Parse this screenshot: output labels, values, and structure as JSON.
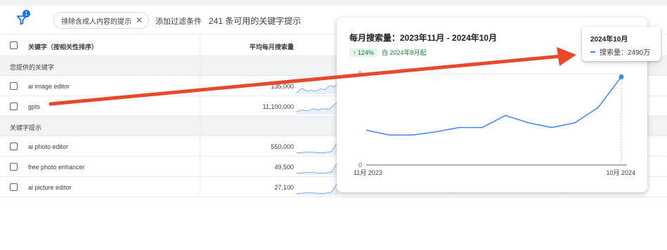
{
  "toolbar": {
    "filter_badge": "1",
    "chip_label": "排除含成人内容的提示",
    "add_filter": "添加过滤条件",
    "count_text": "241 条可用的关键字提示"
  },
  "table": {
    "header": {
      "keyword": "关键字（按相关性排序）",
      "volume": "平均每月搜索量"
    },
    "groups": [
      {
        "label": "您提供的关键字",
        "rows": [
          {
            "keyword": "ai image editor",
            "volume": "135,000"
          },
          {
            "keyword": "gpts",
            "volume": "11,100,000"
          }
        ]
      },
      {
        "label": "关键字提示",
        "rows": [
          {
            "keyword": "ai photo editor",
            "volume": "550,000"
          },
          {
            "keyword": "free photo enhancer",
            "volume": "49,500"
          },
          {
            "keyword": "ai picture editor",
            "volume": "27,100"
          }
        ]
      }
    ]
  },
  "popover": {
    "title": "每月搜索量：2023年11月 - 2024年10月",
    "growth_percent": "124%",
    "growth_since": "自 2024年8月起"
  },
  "tooltip": {
    "date": "2024年10月",
    "series_label": "搜索量：2490万"
  },
  "chart_data": {
    "type": "line",
    "x_start_label": "11月 2023",
    "x_end_label": "10月 2024",
    "y_zero_label": "0",
    "y_top_label": "0",
    "series": [
      {
        "values": [
          6.6,
          5.7,
          5.7,
          6.3,
          7.1,
          7.1,
          9.4,
          8.0,
          7.1,
          8.0,
          10.9,
          16.7
        ]
      }
    ],
    "colors": {
      "line": "#4285f4",
      "axis": "#5f6368",
      "grid": "#e8eaed"
    },
    "grid": true
  },
  "colors": {
    "annotation_arrow": "#e8492c",
    "accent": "#1a73e8",
    "growth": "#188038"
  }
}
